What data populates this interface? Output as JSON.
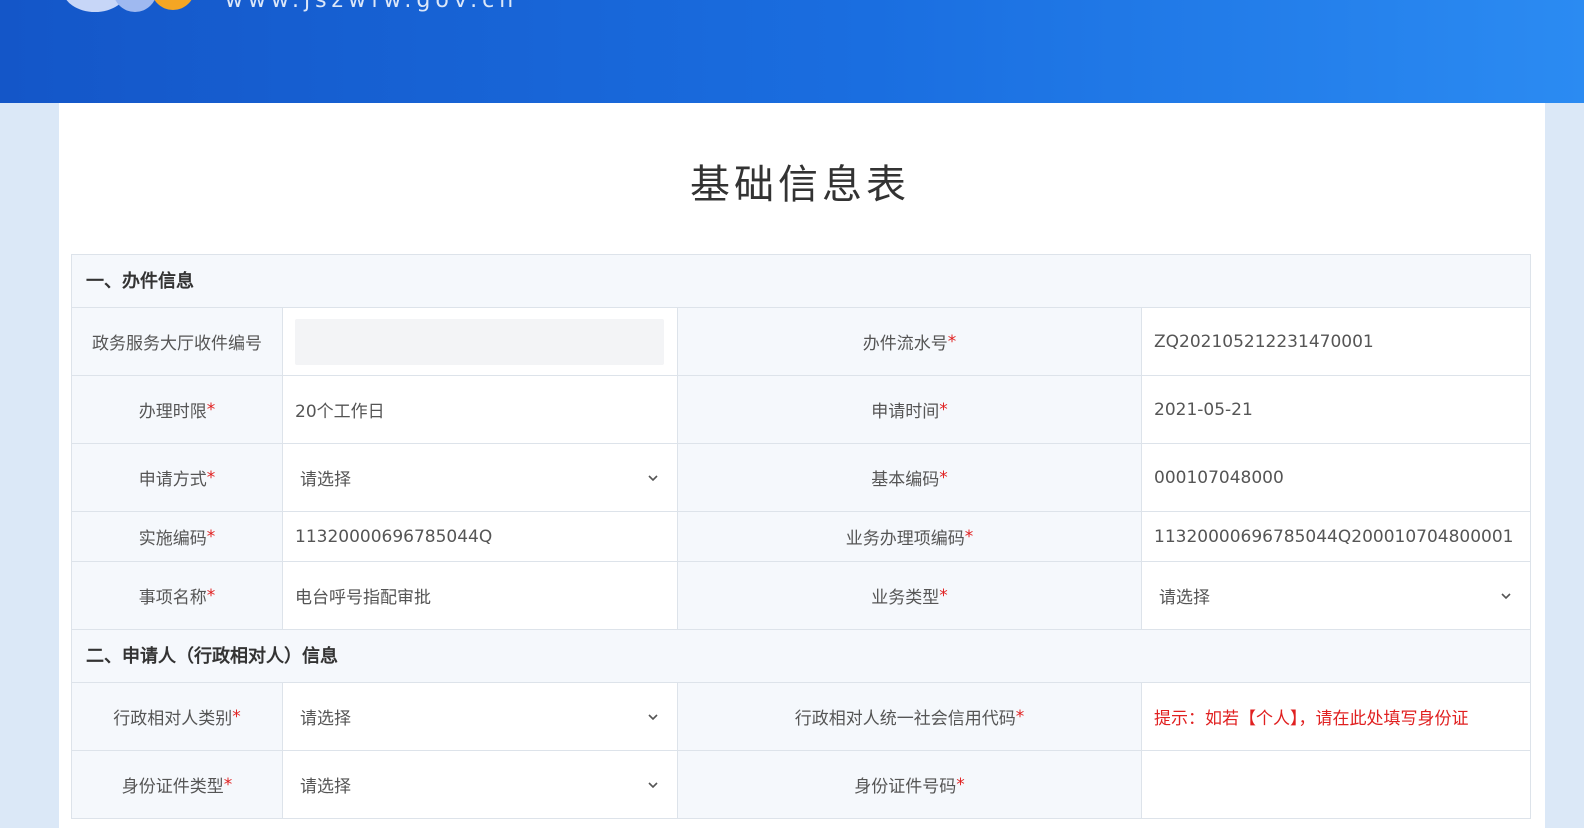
{
  "header": {
    "site_url": "www.jszwfw.gov.cn"
  },
  "page": {
    "title": "基础信息表"
  },
  "sections": {
    "case_info": "一、办件信息",
    "applicant_info": "二、申请人（行政相对人）信息"
  },
  "fields": {
    "hall_receipt_no": {
      "label": "政务服务大厅收件编号",
      "value": ""
    },
    "serial_no": {
      "label": "办件流水号",
      "value": "ZQ202105212231470001"
    },
    "time_limit": {
      "label": "办理时限",
      "value": "20个工作日"
    },
    "apply_time": {
      "label": "申请时间",
      "value": "2021-05-21"
    },
    "apply_method": {
      "label": "申请方式",
      "value": "请选择"
    },
    "basic_code": {
      "label": "基本编码",
      "value": "000107048000"
    },
    "impl_code": {
      "label": "实施编码",
      "value": "11320000696785044Q"
    },
    "biz_item_code": {
      "label": "业务办理项编码",
      "value": "11320000696785044Q200010704800001"
    },
    "item_name": {
      "label": "事项名称",
      "value": "电台呼号指配审批"
    },
    "biz_type": {
      "label": "业务类型",
      "value": "请选择"
    },
    "party_category": {
      "label": "行政相对人类别",
      "value": "请选择"
    },
    "credit_code": {
      "label": "行政相对人统一社会信用代码",
      "placeholder": "提示：如若【个人】，请在此处填写身份证"
    },
    "id_type": {
      "label": "身份证件类型",
      "value": "请选择"
    },
    "id_number": {
      "label": "身份证件号码",
      "value": ""
    }
  },
  "required_mark": "*",
  "colors": {
    "header_start": "#1456c8",
    "header_end": "#2b8bf2",
    "required": "#e02020"
  }
}
